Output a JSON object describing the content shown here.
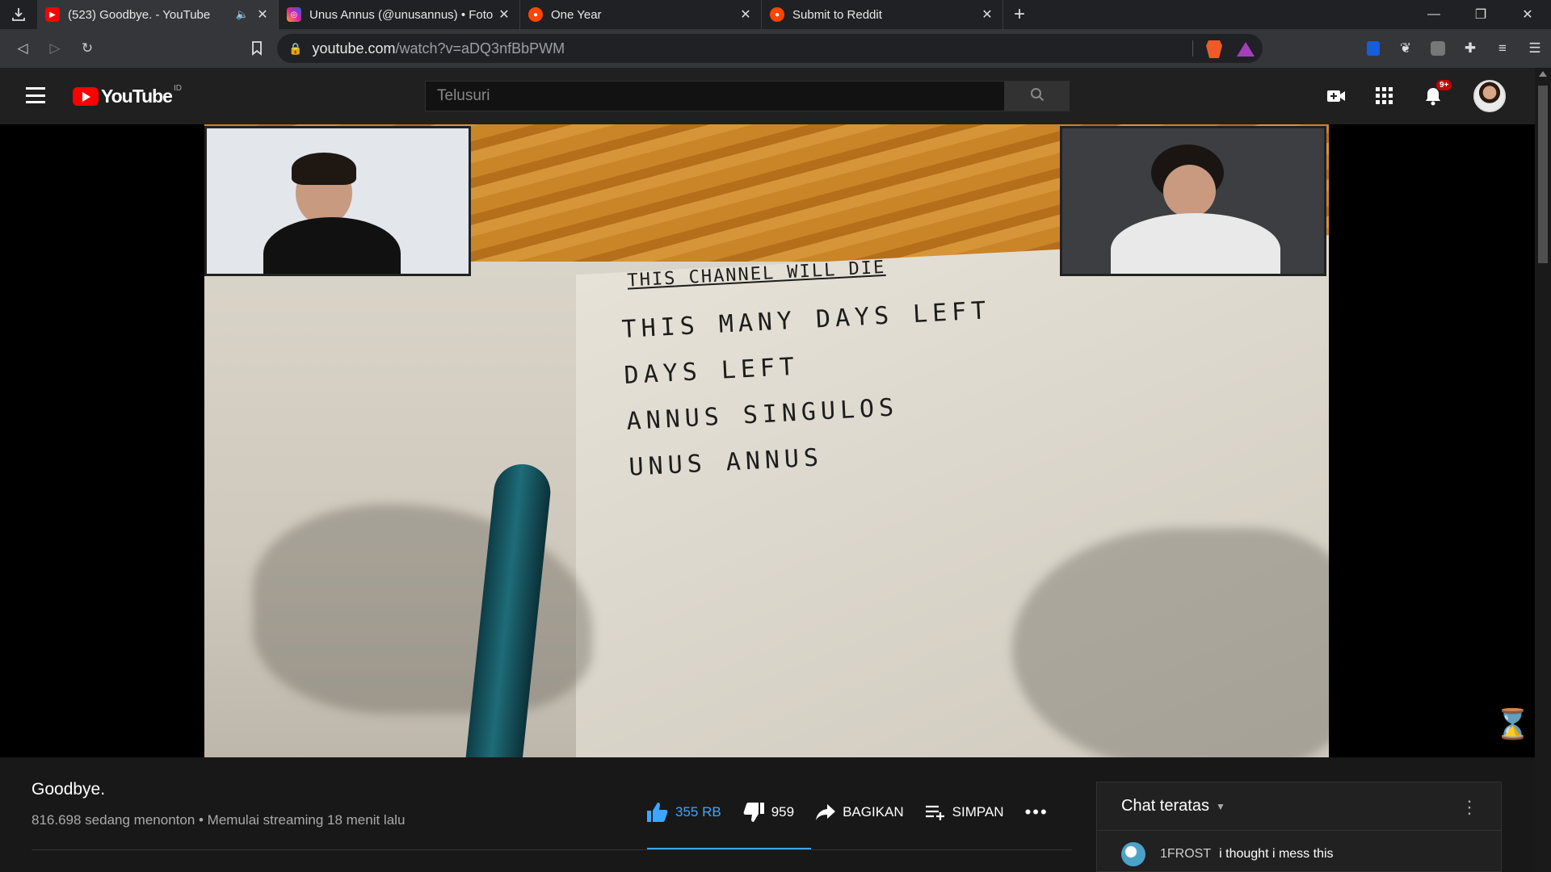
{
  "browser": {
    "tabs": [
      {
        "title": "(523) Goodbye. - YouTube",
        "favicon": "youtube-icon",
        "active": true,
        "audio": true
      },
      {
        "title": "Unus Annus (@unusannus) • Foto",
        "favicon": "instagram-icon",
        "active": false
      },
      {
        "title": "One Year",
        "favicon": "reddit-icon",
        "active": false
      },
      {
        "title": "Submit to Reddit",
        "favicon": "reddit-icon",
        "active": false
      }
    ],
    "url_domain": "youtube.com",
    "url_path": "/watch?v=aDQ3nfBbPWM"
  },
  "youtube": {
    "logo_text": "YouTube",
    "country_code": "ID",
    "search_placeholder": "Telusuri",
    "notification_count": "9+"
  },
  "video": {
    "notebook_lines": [
      "THIS CHANNEL WILL DIE",
      "THIS MANY DAYS LEFT",
      "DAYS LEFT",
      "ANNUS SINGULOS",
      "UNUS ANNUS"
    ],
    "title": "Goodbye.",
    "meta": "816.698 sedang menonton • Memulai streaming 18 menit lalu",
    "likes": "355 RB",
    "dislikes": "959",
    "share_label": "BAGIKAN",
    "save_label": "SIMPAN"
  },
  "chat": {
    "header": "Chat teratas",
    "messages": [
      {
        "author": "1FROST",
        "text": "i thought i mess this"
      }
    ]
  },
  "colors": {
    "youtube_red": "#ff0000",
    "like_blue": "#3ea6ff",
    "background": "#0f0f0f"
  }
}
